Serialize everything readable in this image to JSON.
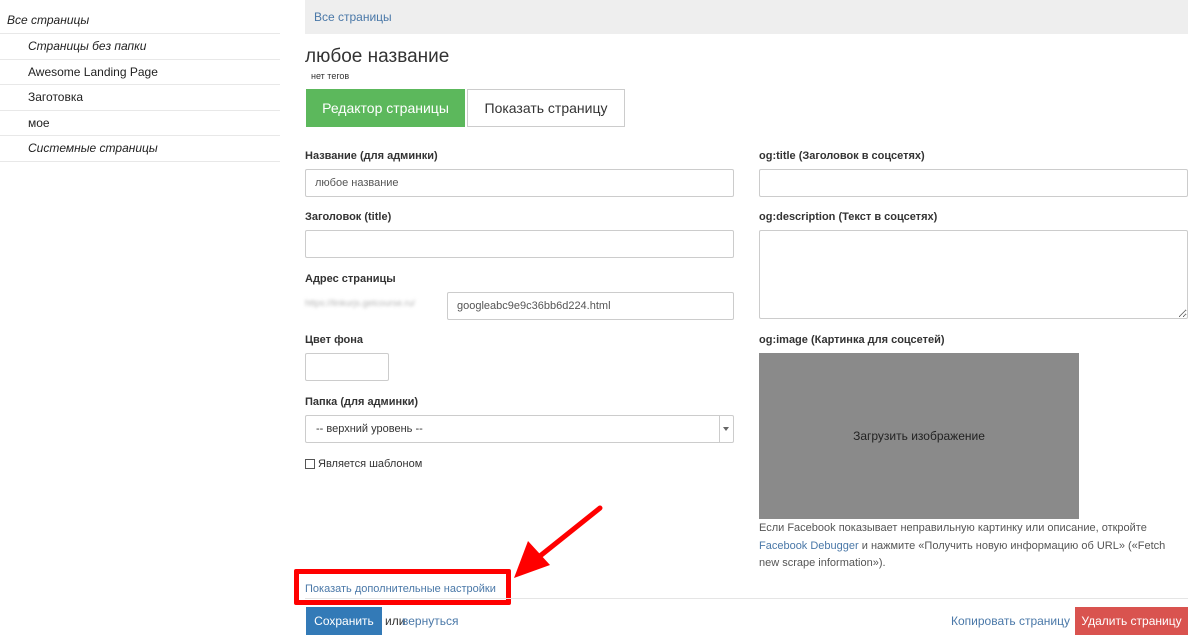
{
  "sidebar": {
    "items": [
      {
        "label": "Все страницы"
      },
      {
        "label": "Страницы без папки"
      },
      {
        "label": "Awesome Landing Page"
      },
      {
        "label": "Заготовка"
      },
      {
        "label": "мое"
      },
      {
        "label": "Системные страницы"
      }
    ]
  },
  "breadcrumb": {
    "label": "Все страницы"
  },
  "page": {
    "title": "любое название",
    "tags": "нет тегов"
  },
  "tabs": {
    "editor": "Редактор страницы",
    "show": "Показать страницу"
  },
  "form": {
    "admin_name_label": "Название (для админки)",
    "admin_name_value": "любое название",
    "title_label": "Заголовок (title)",
    "title_value": "",
    "address_label": "Адрес страницы",
    "address_prefix": "https://linkurjs.getcourse.ru/",
    "address_value": "googleabc9e9c36bb6d224.html",
    "bg_color_label": "Цвет фона",
    "folder_label": "Папка (для админки)",
    "folder_value": "-- верхний уровень --",
    "template_label": "Является шаблоном",
    "og_title_label": "og:title (Заголовок в соцсетях)",
    "og_description_label": "og:description (Текст в соцсетях)",
    "og_image_label": "og:image (Картинка для соцсетей)",
    "upload_label": "Загрузить изображение",
    "help_before": "Если Facebook показывает неправильную картинку или описание, откройте ",
    "help_link": "Facebook Debugger",
    "help_after": " и нажмите «Получить новую информацию об URL» («Fetch new scrape information»)."
  },
  "footer": {
    "advanced_link": "Показать дополнительные настройки",
    "save": "Сохранить",
    "or": "или",
    "back": "вернуться",
    "copy": "Копировать страницу",
    "delete": "Удалить страницу"
  },
  "colors": {
    "primary_green": "#5cb85c",
    "primary_blue": "#337ab7",
    "danger_red": "#d9534f",
    "link_blue": "#4a78a8",
    "annotation_red": "#ff0000"
  }
}
